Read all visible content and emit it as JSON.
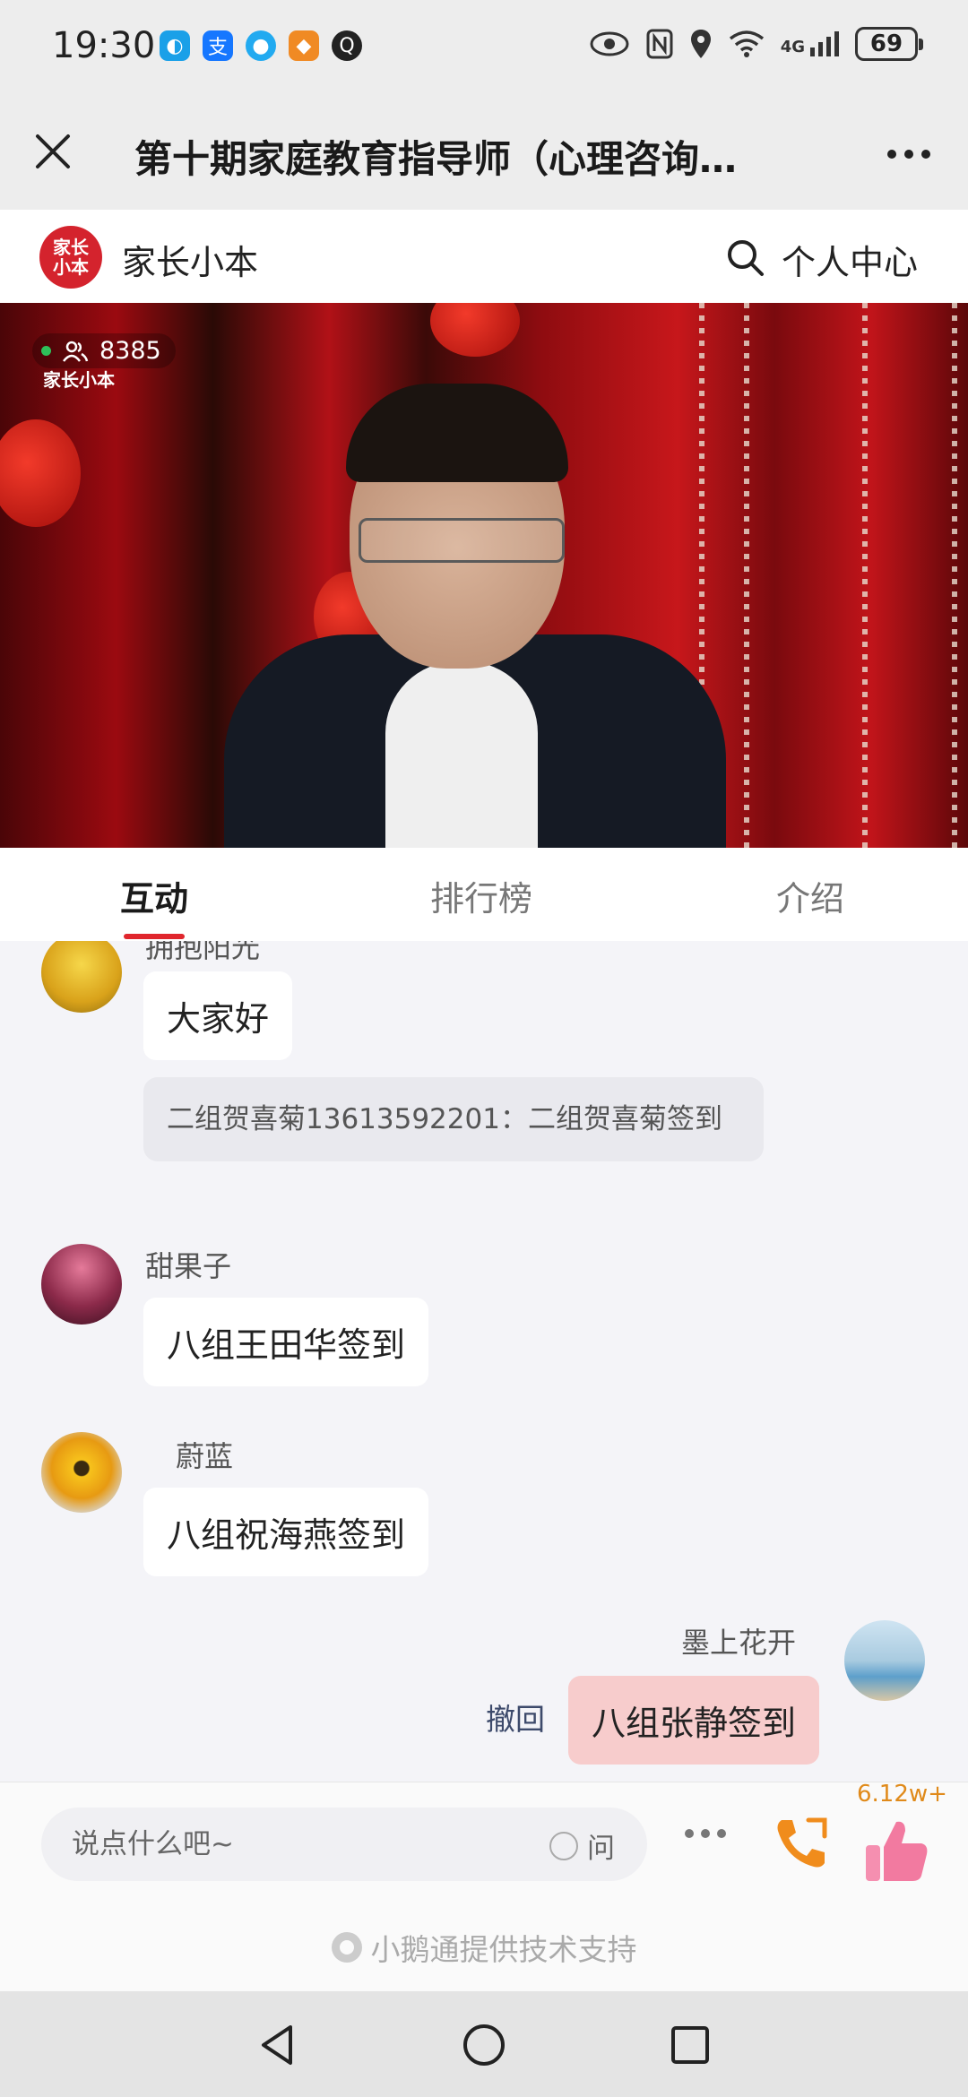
{
  "status_bar": {
    "time": "19:30",
    "network": "4G",
    "battery": "69"
  },
  "title_bar": {
    "title": "第十期家庭教育指导师（心理咨询…"
  },
  "brand": {
    "logo_text": "家长小本",
    "name": "家长小本",
    "profile_label": "个人中心"
  },
  "video": {
    "viewer_count": "8385",
    "watermark": "家长小本"
  },
  "tabs": [
    {
      "label": "互动"
    },
    {
      "label": "排行榜"
    },
    {
      "label": "介绍"
    }
  ],
  "chat": {
    "messages": [
      {
        "nickname": "拥抱阳光",
        "text": "大家好",
        "quote": "二组贺喜菊13613592201：二组贺喜菊签到"
      },
      {
        "nickname": "甜果子",
        "text": "八组王田华签到"
      },
      {
        "nickname": "蔚蓝",
        "text": "八组祝海燕签到"
      },
      {
        "nickname": "墨上花开",
        "text": "八组张静签到",
        "recall_label": "撤回"
      }
    ]
  },
  "input": {
    "placeholder": "说点什么吧~",
    "ask_label": "问",
    "like_count": "6.12w+",
    "support_text": "小鹅通提供技术支持"
  },
  "colors": {
    "accent": "#e0262d",
    "logo_bg": "#d4232d",
    "my_bubble": "#f7cccc",
    "call_icon": "#f08c1c",
    "like_icon": "#f27aa0"
  }
}
